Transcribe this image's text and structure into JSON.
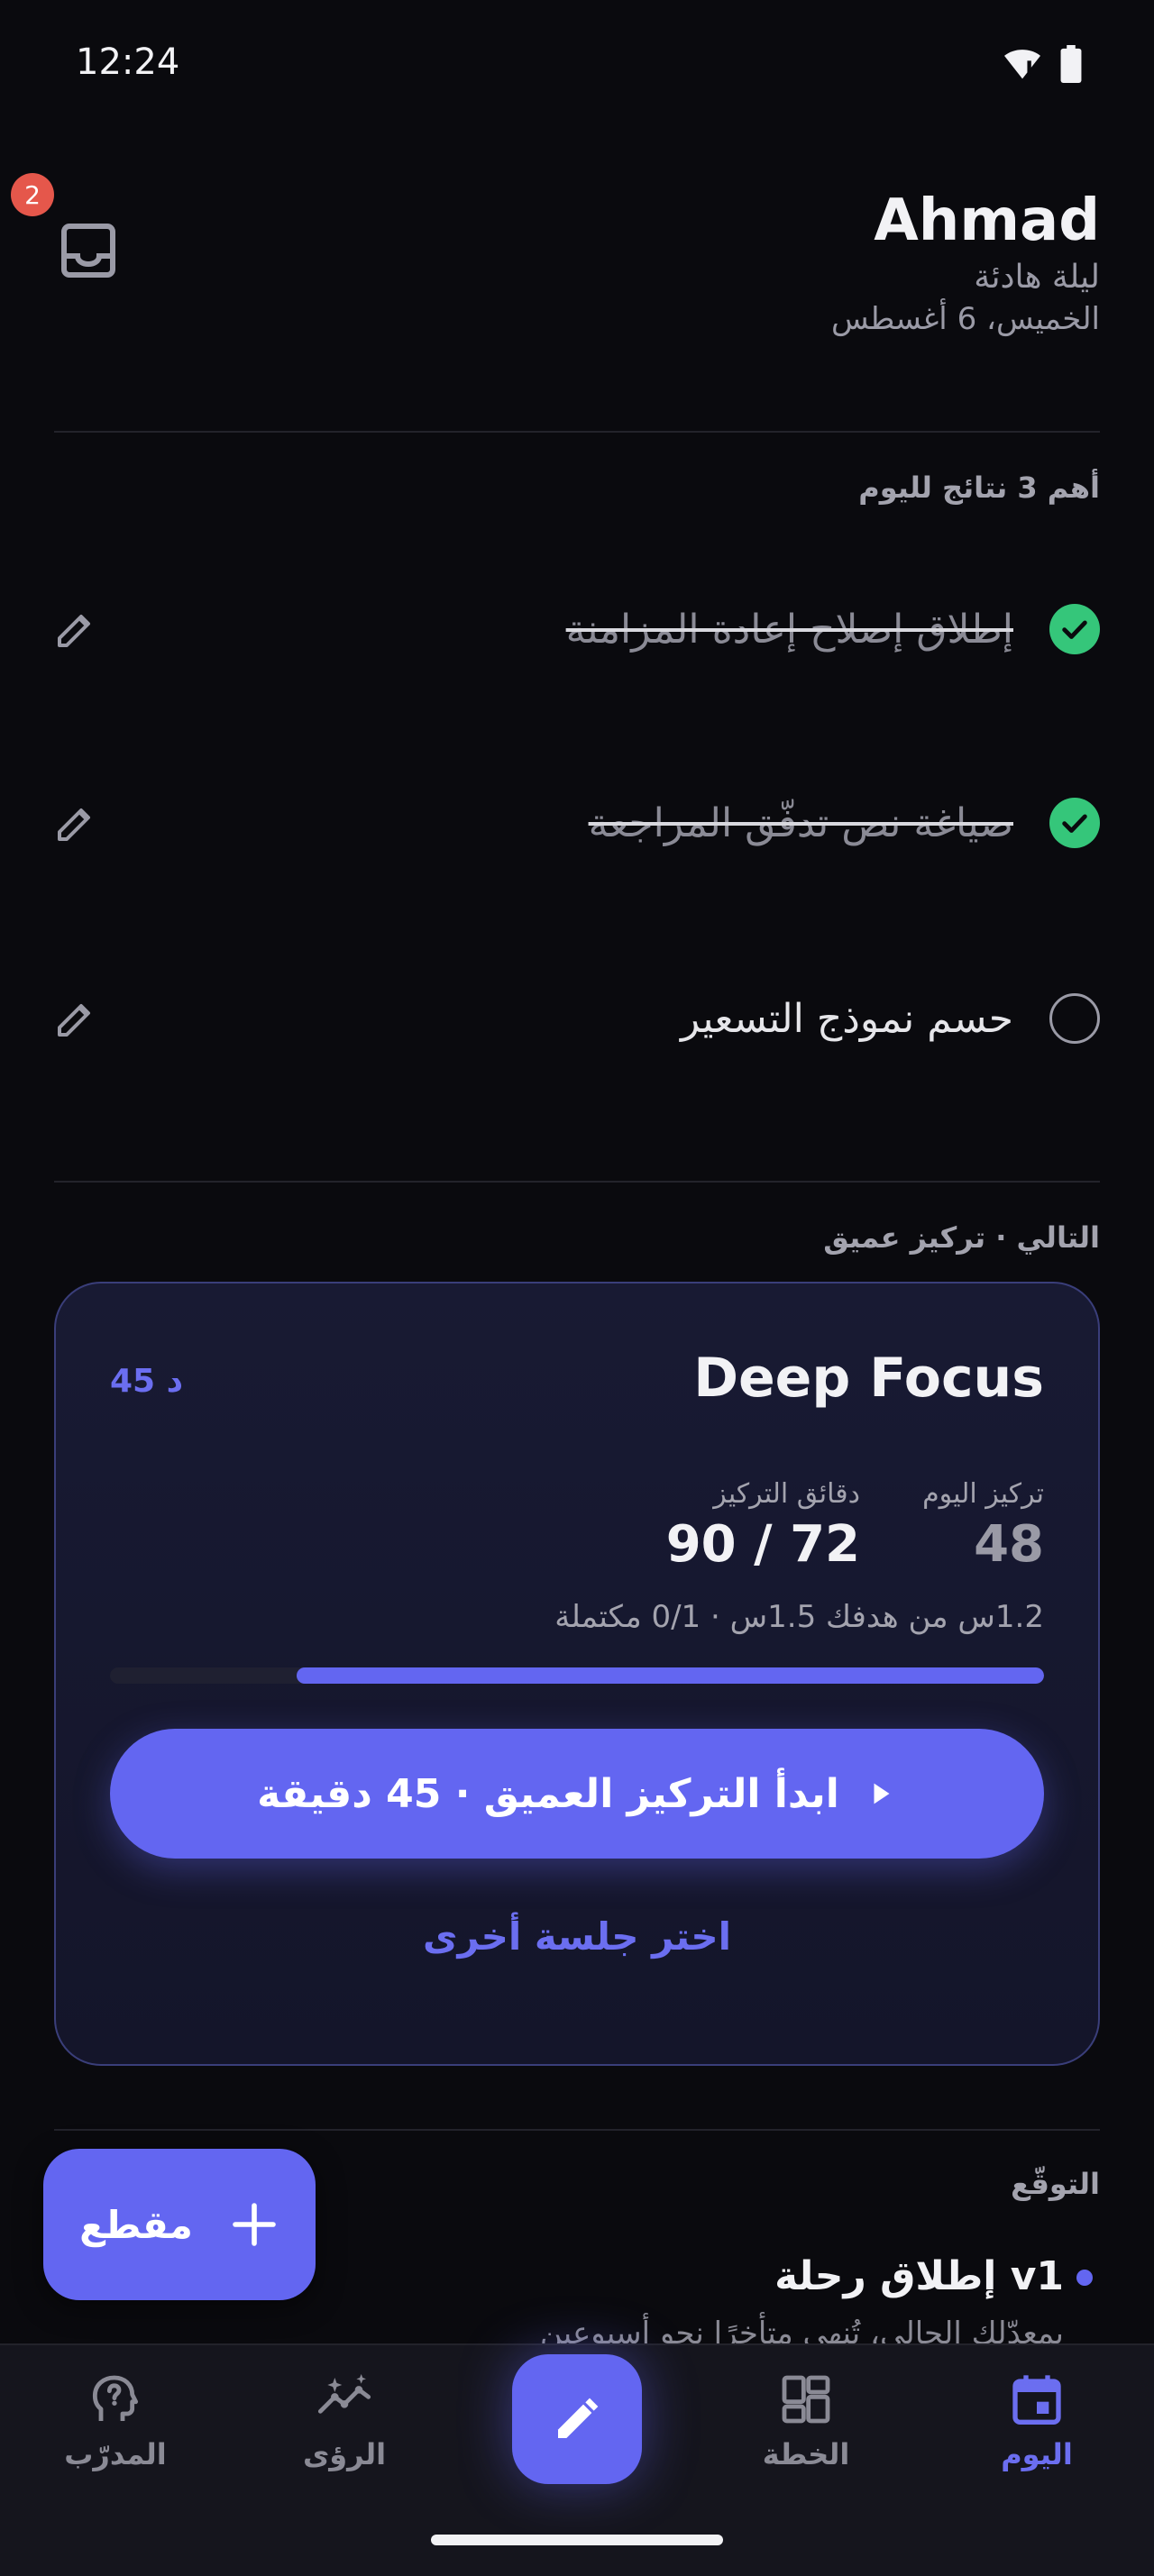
{
  "status": {
    "time": "12:24"
  },
  "inbox": {
    "badge": "2"
  },
  "header": {
    "name": "Ahmad",
    "subtitle": "ليلة هادئة",
    "date": "الخميس، 6 أغسطس"
  },
  "top_results": {
    "title": "أهم 3 نتائج لليوم",
    "items": [
      {
        "text": "إطلاق إصلاح إعادة المزامنة",
        "done": true
      },
      {
        "text": "صياغة نص تدفّق المراجعة",
        "done": true
      },
      {
        "text": "حسم نموذج التسعير",
        "done": false
      }
    ]
  },
  "next": {
    "title": "التالي · تركيز عميق",
    "card": {
      "title": "Deep Focus",
      "duration": "45 د",
      "stat_focus_label": "تركيز اليوم",
      "stat_focus_value": "48",
      "stat_minutes_label": "دقائق التركيز",
      "stat_minutes_value": "90 / 72",
      "progress_text": "1.2س من هدفك 1.5س · 0/1 مكتملة",
      "progress_fraction": 0.8,
      "cta": "ابدأ التركيز العميق · 45 دقيقة",
      "alt": "اختر جلسة أخرى"
    }
  },
  "forecast": {
    "title": "التوقّع",
    "item_title": "إطلاق رحلة v1",
    "item_sub": "بمعدّلك الحالي، تُنهي متأخرًا نحو أسبوعين"
  },
  "fab": {
    "label": "مقطع"
  },
  "nav": {
    "coach": "المدرّب",
    "insights": "الرؤى",
    "plan": "الخطة",
    "today": "اليوم"
  },
  "colors": {
    "accent": "#6366f1",
    "success": "#35c67a",
    "badge": "#e5574b",
    "background": "#0a0a0e"
  }
}
